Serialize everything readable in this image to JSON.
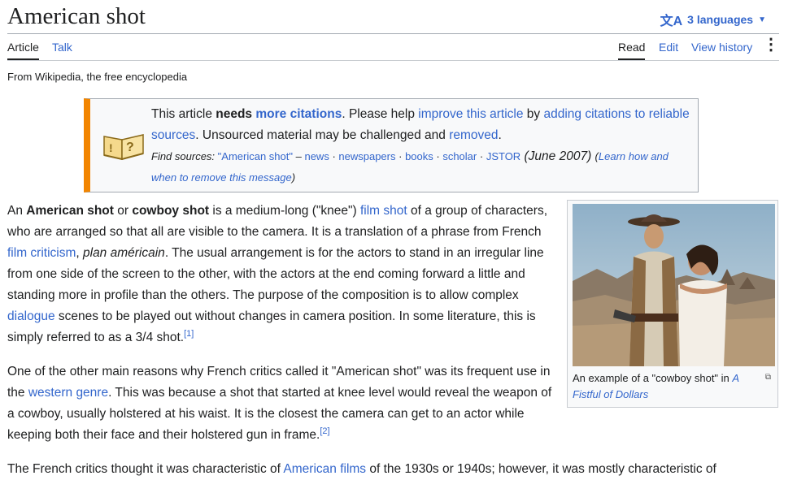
{
  "header": {
    "title": "American shot",
    "languages_label": "3 languages"
  },
  "tabs": {
    "article": "Article",
    "talk": "Talk",
    "read": "Read",
    "edit": "Edit",
    "view_history": "View history"
  },
  "tagline": "From Wikipedia, the free encyclopedia",
  "ambox": {
    "t1": "This article ",
    "t2": "needs",
    "t3": " ",
    "t4": "more citations",
    "t5": ". Please help ",
    "t6": "improve this article",
    "t7": " by ",
    "t8": "adding citations to reliable sources",
    "t9": ". Unsourced material may be challenged and ",
    "t10": "removed",
    "t11": ".",
    "find_sources": "Find sources:",
    "src_query": "\"American shot\"",
    "dash": " – ",
    "src_news": "news",
    "src_newspapers": "newspapers",
    "src_books": "books",
    "src_scholar": "scholar",
    "src_jstor": "JSTOR",
    "sep": " · ",
    "date": " (June 2007) ",
    "learn_open": "(",
    "learn": "Learn how and when to remove this message",
    "learn_close": ")"
  },
  "para1": {
    "a1": "An ",
    "a2": "American shot",
    "a3": " or ",
    "a4": "cowboy shot",
    "a5": " is a medium-long (\"knee\") ",
    "a6": "film shot",
    "a7": " of a group of characters, who are arranged so that all are visible to the camera. It is a translation of a phrase from French ",
    "a8": "film criticism",
    "a9": ", ",
    "a10": "plan américain",
    "a11": ". The usual arrangement is for the actors to stand in an irregular line from one side of the screen to the other, with the actors at the end coming forward a little and standing more in profile than the others. The purpose of the composition is to allow complex ",
    "a12": "dialogue",
    "a13": " scenes to be played out without changes in camera position. In some literature, this is simply referred to as a 3/4 shot.",
    "ref1": "[1]"
  },
  "para2": {
    "b1": "One of the other main reasons why French critics called it \"American shot\" was its frequent use in the ",
    "b2": "western genre",
    "b3": ". This was because a shot that started at knee level would reveal the weapon of a cowboy, usually holstered at his waist. It is the closest the camera can get to an actor while keeping both their face and their holstered gun in frame.",
    "ref2": "[2]"
  },
  "para3": {
    "c1": "The French critics thought it was characteristic of ",
    "c2": "American films",
    "c3": " of the 1930s or 1940s; however, it was mostly characteristic of"
  },
  "figure": {
    "caption_prefix": "An example of a \"cowboy shot\" in ",
    "caption_link": "A Fistful of Dollars",
    "enlarge_icon": "magnify-icon"
  }
}
